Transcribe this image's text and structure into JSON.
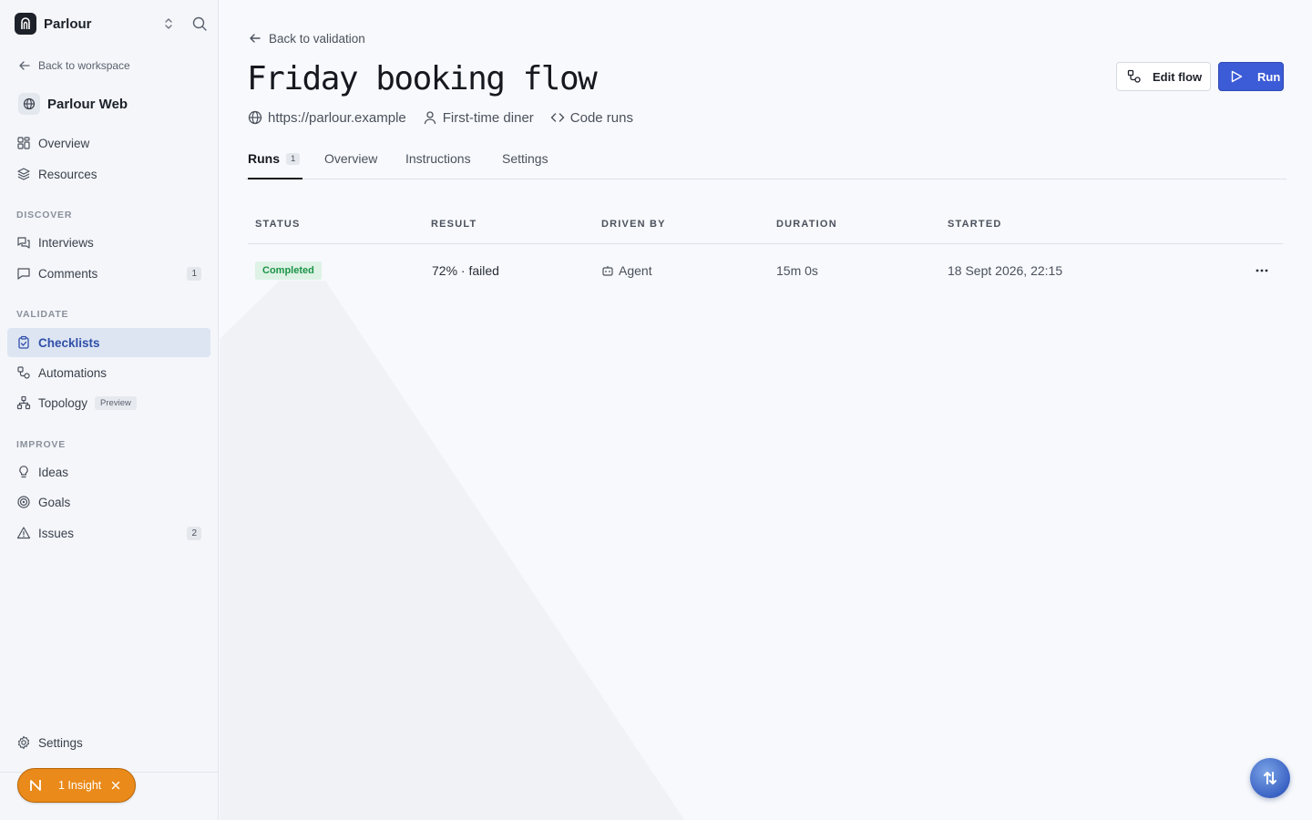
{
  "workspace": {
    "name": "Parlour"
  },
  "sidebar": {
    "back_label": "Back to workspace",
    "project_name": "Parlour Web",
    "top_items": [
      {
        "label": "Overview"
      },
      {
        "label": "Resources"
      }
    ],
    "sections": {
      "discover": "DISCOVER",
      "validate": "VALIDATE",
      "improve": "IMPROVE"
    },
    "discover_items": [
      {
        "label": "Interviews"
      },
      {
        "label": "Comments",
        "count": "1"
      }
    ],
    "validate_items": [
      {
        "label": "Checklists"
      },
      {
        "label": "Automations"
      },
      {
        "label": "Topology",
        "badge": "Preview"
      }
    ],
    "improve_items": [
      {
        "label": "Ideas"
      },
      {
        "label": "Goals"
      },
      {
        "label": "Issues",
        "count": "2"
      }
    ],
    "settings_label": "Settings",
    "insight_label": "1 Insight"
  },
  "page": {
    "back_label": "Back to validation",
    "title": "Friday booking flow",
    "meta": {
      "url": "https://parlour.example",
      "persona": "First-time diner",
      "mode": "Code runs"
    },
    "actions": {
      "edit_label": "Edit flow",
      "run_label": "Run"
    },
    "tabs": [
      {
        "label": "Runs",
        "count": "1"
      },
      {
        "label": "Overview"
      },
      {
        "label": "Instructions"
      },
      {
        "label": "Settings"
      }
    ],
    "table": {
      "headers": {
        "status": "STATUS",
        "result": "RESULT",
        "driven_by": "DRIVEN BY",
        "duration": "DURATION",
        "started": "STARTED"
      },
      "rows": [
        {
          "status": "Completed",
          "result": "72% · failed",
          "driven_by": "Agent",
          "duration": "15m 0s",
          "started": "18 Sept 2026, 22:15"
        }
      ]
    }
  },
  "colors": {
    "accent": "#3c5bd6",
    "active_nav_bg": "#dde5f3",
    "success": "#1b9447",
    "insight": "#e98a1a"
  }
}
